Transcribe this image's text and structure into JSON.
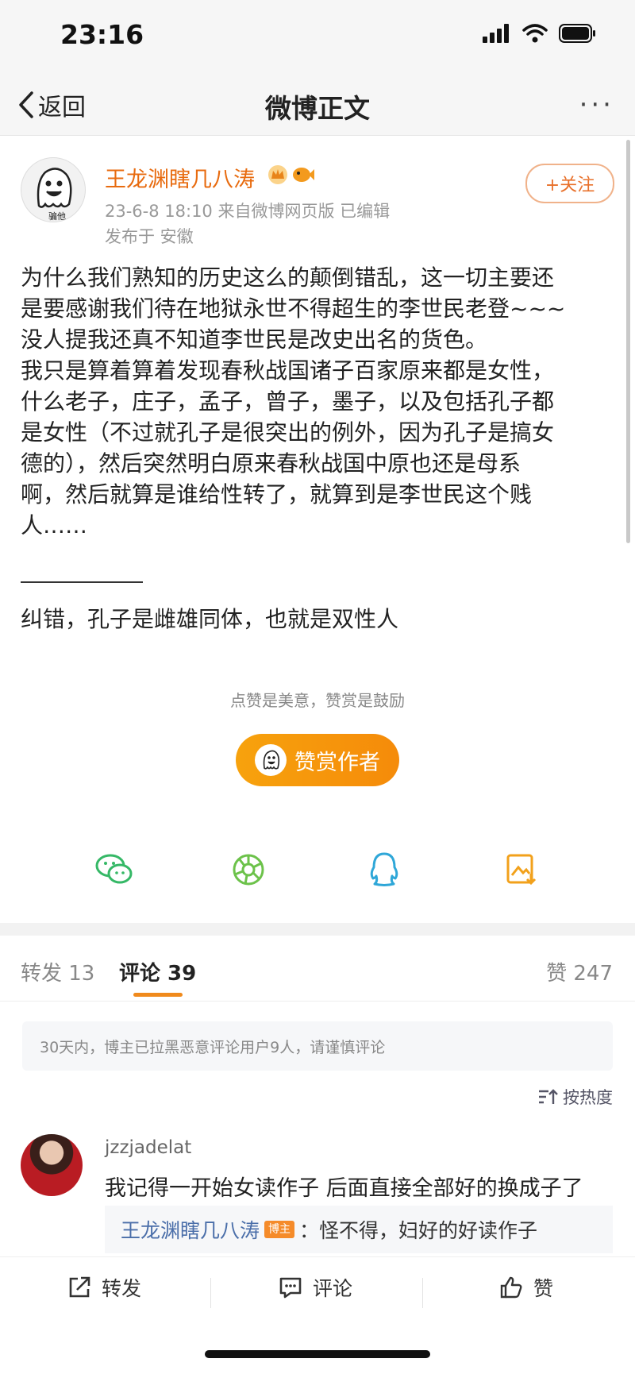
{
  "status": {
    "time": "23:16"
  },
  "nav": {
    "back": "返回",
    "title": "微博正文",
    "more": "···"
  },
  "post": {
    "avatar_caption": "骗他",
    "author": "王龙渊瞎几八涛",
    "meta": "23-6-8 18:10  来自微博网页版  已编辑",
    "location": "发布于 安徽",
    "follow": "+关注",
    "body": "为什么我们熟知的历史这么的颠倒错乱，这一切主要还\n是要感谢我们待在地狱永世不得超生的李世民老登~~~\n没人提我还真不知道李世民是改史出名的货色。\n我只是算着算着发现春秋战国诸子百家原来都是女性，\n什么老子，庄子，孟子，曾子，墨子，以及包括孔子都\n是女性（不过就孔子是很突出的例外，因为孔子是搞女\n德的），然后突然明白原来春秋战国中原也还是母系\n啊，然后就算是谁给性转了，就算到是李世民这个贱\n人……",
    "correction": "纠错，孔子是雌雄同体，也就是双性人"
  },
  "reward": {
    "note": "点赞是美意，赞赏是鼓励",
    "button": "赞赏作者",
    "icon_caption": "骗他"
  },
  "share": [
    "wechat-icon",
    "moments-icon",
    "qq-icon",
    "save-image-icon"
  ],
  "tabs": {
    "repost": "转发 13",
    "comments": "评论 39",
    "likes": "赞 247"
  },
  "notice": "30天内，博主已拉黑恶意评论用户9人，请谨慎评论",
  "sort": "按热度",
  "comment": {
    "user": "jzzjadelat",
    "text": "我记得一开始女读作子 后面直接全部好的换成子了",
    "reply_user": "王龙渊瞎几八涛",
    "reply_badge": "博主",
    "reply_text": "：怪不得，妇好的好读作子"
  },
  "bottom": {
    "repost": "转发",
    "comment": "评论",
    "like": "赞"
  },
  "colors": {
    "accent": "#e86b0f",
    "reward": "#f7a20d",
    "link": "#4a6ea9"
  }
}
